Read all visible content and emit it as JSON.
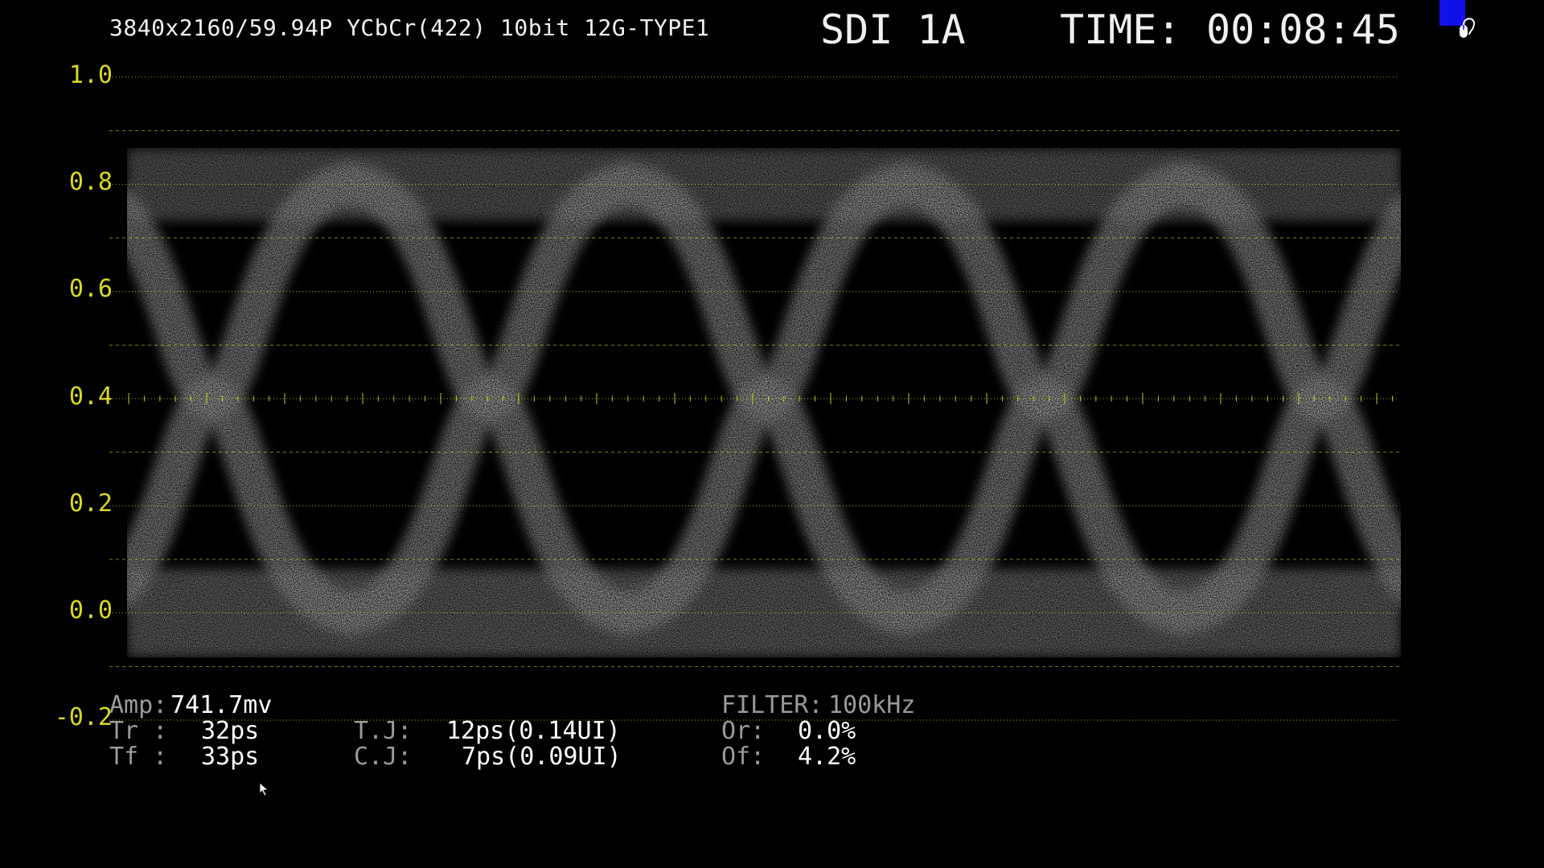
{
  "header": {
    "format": "3840x2160/59.94P YCbCr(422) 10bit 12G-TYPE1",
    "input": "SDI 1A",
    "time_label": "TIME:",
    "time_value": "00:08:45"
  },
  "y_axis": {
    "labels": [
      "1.0",
      "0.8",
      "0.6",
      "0.4",
      "0.2",
      "0.0",
      "-0.2"
    ],
    "range": [
      -0.2,
      1.0
    ],
    "major_step": 0.2,
    "minor_step": 0.1
  },
  "eye_pattern": {
    "crossings": 5,
    "high_level": 0.8,
    "low_level": 0.0
  },
  "measurements": {
    "amp_label": "Amp:",
    "amp_value": "741.7mv",
    "tr_label": "Tr :",
    "tr_value": "32ps",
    "tf_label": "Tf :",
    "tf_value": "33ps",
    "tj_label": "T.J:",
    "tj_value": "12ps(0.14UI)",
    "cj_label": "C.J:",
    "cj_value": "7ps(0.09UI)",
    "filter_label": "FILTER:",
    "filter_value": "100kHz",
    "or_label": "Or:",
    "or_value": "0.0%",
    "of_label": "Of:",
    "of_value": "4.2%"
  },
  "colors": {
    "graticule": "#d8d820",
    "trace": "#ffffff",
    "background": "#000000",
    "mouse_icon_bg": "#1010e8"
  },
  "icons": {
    "mouse": "mouse-icon",
    "cursor": "cursor-icon"
  }
}
